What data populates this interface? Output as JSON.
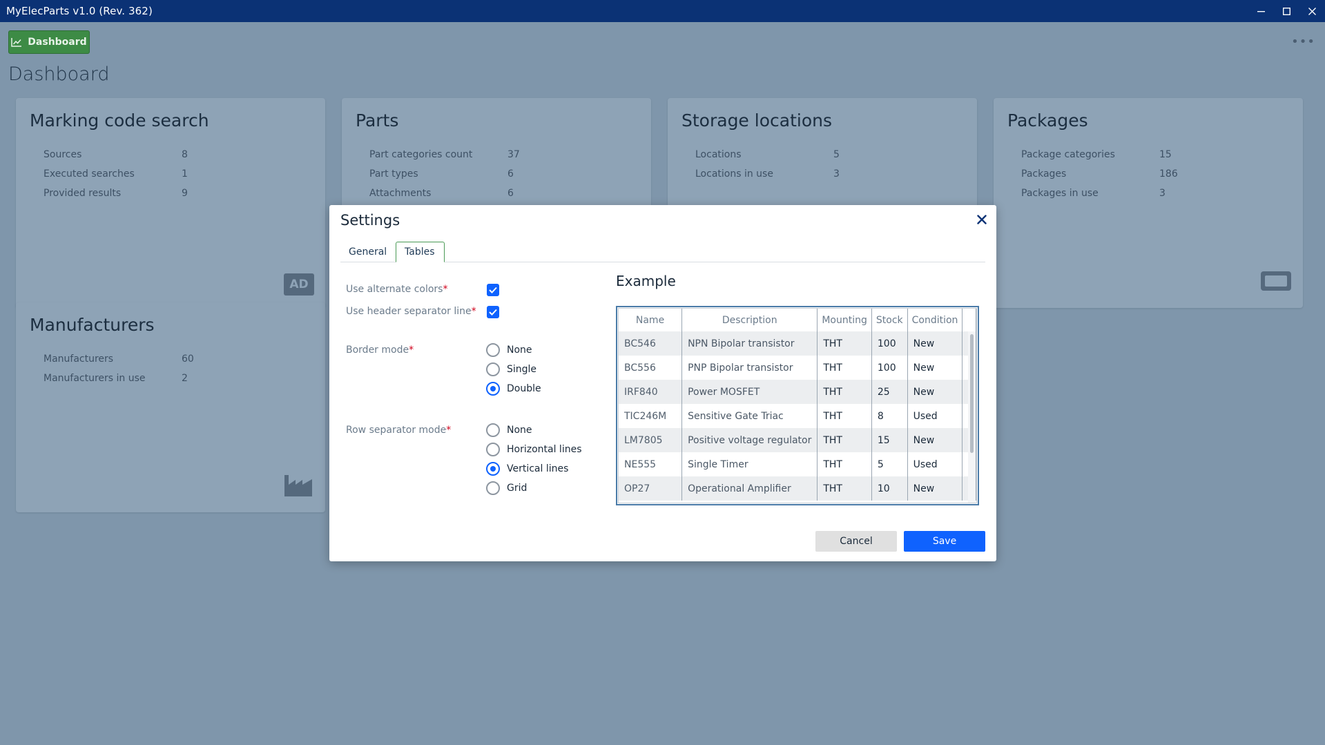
{
  "window": {
    "title": "MyElecParts v1.0 (Rev. 362)"
  },
  "nav": {
    "dashboard_label": "Dashboard"
  },
  "page": {
    "title": "Dashboard"
  },
  "cards": {
    "marking": {
      "title": "Marking code search",
      "rows": [
        {
          "label": "Sources",
          "value": "8"
        },
        {
          "label": "Executed searches",
          "value": "1"
        },
        {
          "label": "Provided results",
          "value": "9"
        }
      ],
      "icon_text": "AD"
    },
    "parts": {
      "title": "Parts",
      "rows": [
        {
          "label": "Part categories count",
          "value": "37"
        },
        {
          "label": "Part types",
          "value": "6"
        },
        {
          "label": "Attachments",
          "value": "6"
        }
      ]
    },
    "storage": {
      "title": "Storage locations",
      "rows": [
        {
          "label": "Locations",
          "value": "5"
        },
        {
          "label": "Locations in use",
          "value": "3"
        }
      ]
    },
    "packages": {
      "title": "Packages",
      "rows": [
        {
          "label": "Package categories",
          "value": "15"
        },
        {
          "label": "Packages",
          "value": "186"
        },
        {
          "label": "Packages in use",
          "value": "3"
        }
      ]
    },
    "manufacturers": {
      "title": "Manufacturers",
      "rows": [
        {
          "label": "Manufacturers",
          "value": "60"
        },
        {
          "label": "Manufacturers in use",
          "value": "2"
        }
      ]
    }
  },
  "settings": {
    "title": "Settings",
    "tabs": {
      "general": "General",
      "tables": "Tables"
    },
    "alt_colors_label": "Use alternate colors",
    "header_sep_label": "Use header separator line",
    "required_mark": "*",
    "border_mode": {
      "label": "Border mode",
      "options": [
        "None",
        "Single",
        "Double"
      ],
      "selected": "Double"
    },
    "row_sep_mode": {
      "label": "Row separator mode",
      "options": [
        "None",
        "Horizontal lines",
        "Vertical lines",
        "Grid"
      ],
      "selected": "Vertical lines"
    },
    "example": {
      "title": "Example",
      "columns": [
        "Name",
        "Description",
        "Mounting",
        "Stock",
        "Condition"
      ],
      "rows": [
        [
          "BC546",
          "NPN Bipolar transistor",
          "THT",
          "100",
          "New"
        ],
        [
          "BC556",
          "PNP Bipolar transistor",
          "THT",
          "100",
          "New"
        ],
        [
          "IRF840",
          "Power MOSFET",
          "THT",
          "25",
          "New"
        ],
        [
          "TIC246M",
          "Sensitive Gate Triac",
          "THT",
          "8",
          "Used"
        ],
        [
          "LM7805",
          "Positive voltage regulator",
          "THT",
          "15",
          "New"
        ],
        [
          "NE555",
          "Single Timer",
          "THT",
          "5",
          "Used"
        ],
        [
          "OP27",
          "Operational Amplifier",
          "THT",
          "10",
          "New"
        ]
      ]
    },
    "cancel_label": "Cancel",
    "save_label": "Save"
  },
  "colors": {
    "titlebar": "#0b3275",
    "accent_blue": "#0f62fe",
    "nav_green": "#3d8b45",
    "required_red": "#d0021b"
  }
}
